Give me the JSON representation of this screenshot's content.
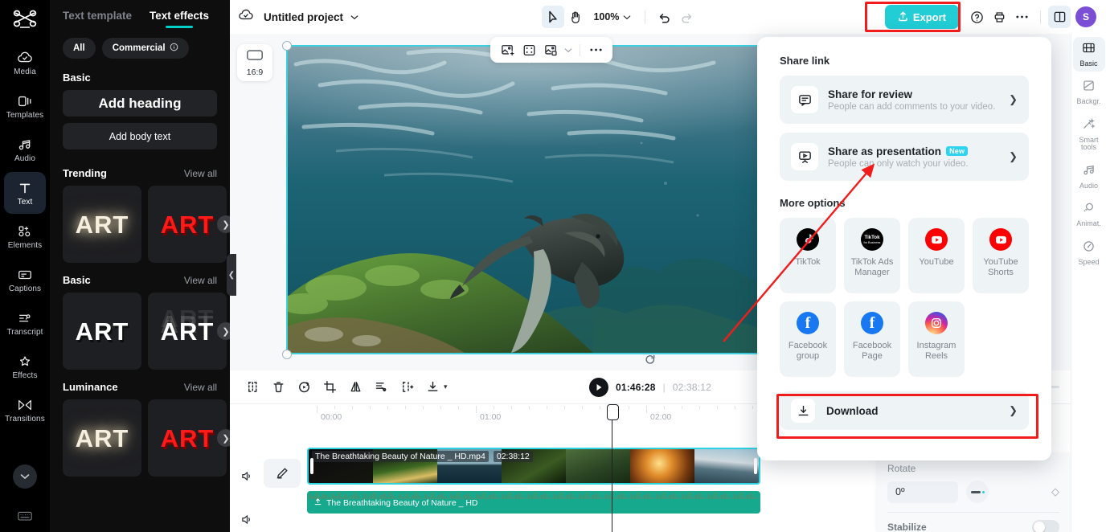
{
  "app": {
    "name": "CapCut",
    "logo_icon": "capcut-logo-icon"
  },
  "left_rail": {
    "items": [
      {
        "label": "Media",
        "icon": "cloud-media-icon",
        "active": false
      },
      {
        "label": "Templates",
        "icon": "templates-icon",
        "active": false
      },
      {
        "label": "Audio",
        "icon": "music-note-icon",
        "active": false
      },
      {
        "label": "Text",
        "icon": "text-t-icon",
        "active": true
      },
      {
        "label": "Elements",
        "icon": "elements-icon",
        "active": false
      },
      {
        "label": "Captions",
        "icon": "captions-icon",
        "active": false
      },
      {
        "label": "Transcript",
        "icon": "transcript-icon",
        "active": false
      },
      {
        "label": "Effects",
        "icon": "sparkle-effects-icon",
        "active": false
      },
      {
        "label": "Transitions",
        "icon": "transitions-icon",
        "active": false
      }
    ],
    "more_icon": "chevron-down-circle-icon",
    "keyboard_icon": "keyboard-shortcuts-icon"
  },
  "left_panel": {
    "tabs": [
      {
        "label": "Text template",
        "active": false
      },
      {
        "label": "Text effects",
        "active": true
      }
    ],
    "filters": [
      {
        "label": "All",
        "icon": null
      },
      {
        "label": "Commercial",
        "icon": "info-circle-icon"
      }
    ],
    "basic_heading": "Basic",
    "add_heading_label": "Add heading",
    "add_body_label": "Add body text",
    "sections": [
      {
        "title": "Trending",
        "view_all": "View all",
        "items": [
          "ART",
          "ART"
        ]
      },
      {
        "title": "Basic",
        "view_all": "View all",
        "items": [
          "ART",
          "ART"
        ]
      },
      {
        "title": "Luminance",
        "view_all": "View all",
        "items": [
          "ART",
          "ART"
        ]
      }
    ],
    "collapse_icon": "chevron-left-icon"
  },
  "topbar": {
    "cloud_icon": "cloud-saved-icon",
    "project_name": "Untitled project",
    "project_chevron": "chevron-down-icon",
    "select_tool_icon": "cursor-select-icon",
    "hand_tool_icon": "hand-pan-icon",
    "zoom_level": "100%",
    "zoom_chevron": "chevron-down-icon",
    "undo_icon": "undo-icon",
    "redo_icon": "redo-icon",
    "export_label": "Export",
    "export_icon": "export-upload-icon",
    "export_color": "#22cdd6",
    "help_icon": "help-question-icon",
    "print_icon": "print-icon",
    "more_icon": "more-horizontal-icon",
    "layout_icon": "panel-layout-icon",
    "avatar_initial": "S",
    "avatar_color": "#7a4fd6"
  },
  "preview": {
    "ratio_label": "16:9",
    "ratio_icon": "aspect-ratio-icon",
    "scene": "underwater marine iguana swimming over mossy rock",
    "tools": [
      {
        "icon": "add-image-icon",
        "name": "add-image"
      },
      {
        "icon": "fit-to-frame-icon",
        "name": "fit-to-frame"
      },
      {
        "icon": "crop-layer-icon",
        "name": "crop-layer"
      },
      {
        "icon": "chevron-down-icon",
        "name": "crop-dropdown"
      },
      {
        "icon": "more-horizontal-icon",
        "name": "more"
      }
    ],
    "rotate_handle_icon": "rotate-handle-icon",
    "selection_color": "#3ecfe0"
  },
  "player": {
    "tools": [
      {
        "icon": "split-icon",
        "name": "split"
      },
      {
        "icon": "trash-icon",
        "name": "delete"
      },
      {
        "icon": "reverse-icon",
        "name": "reverse"
      },
      {
        "icon": "crop-icon",
        "name": "crop"
      },
      {
        "icon": "mirror-icon",
        "name": "mirror"
      },
      {
        "icon": "cut-scissors-icon",
        "name": "cut"
      },
      {
        "icon": "freeze-icon",
        "name": "freeze"
      },
      {
        "icon": "download-icon",
        "name": "download"
      },
      {
        "icon": "chevron-down-icon",
        "name": "download-dropdown"
      }
    ],
    "play_icon": "play-icon",
    "current_time": "01:46:28",
    "separator": "|",
    "total_time": "02:38:12",
    "mic_icon": "microphone-icon",
    "auto_icon": "auto-enhance-icon",
    "audio_icon": "audio-waveform-icon",
    "zoom_out_icon": "zoom-out-circle-icon"
  },
  "timeline": {
    "ruler_labels": [
      "00:00",
      "01:00",
      "02:00"
    ],
    "tracks": [
      {
        "type": "video",
        "speaker_icon": "speaker-icon",
        "edit_icon": "edit-pencil-icon",
        "clip_name": "The Breathtaking Beauty of Nature _ HD.mp4",
        "clip_duration": "02:38:12"
      },
      {
        "type": "audio",
        "speaker_icon": "speaker-icon",
        "clip_icon": "audio-extract-icon",
        "clip_name": "The Breathtaking Beauty of Nature _ HD",
        "color": "#17a98e"
      }
    ],
    "playhead_icon": "playhead-icon"
  },
  "right_rail": {
    "items": [
      {
        "label": "Basic",
        "icon": "basic-film-icon",
        "active": true
      },
      {
        "label": "Backgr.",
        "icon": "background-icon",
        "active": false
      },
      {
        "label": "Smart tools",
        "icon": "smart-tools-wand-icon",
        "active": false
      },
      {
        "label": "Audio",
        "icon": "music-note-icon",
        "active": false
      },
      {
        "label": "Animat.",
        "icon": "animation-icon",
        "active": false
      },
      {
        "label": "Speed",
        "icon": "speed-gauge-icon",
        "active": false
      }
    ]
  },
  "properties": {
    "rotate_label": "Rotate",
    "rotate_value": "0º",
    "dial_icon": "rotate-dial-icon",
    "keyframe_icon": "keyframe-diamond-icon",
    "stabilize_label": "Stabilize",
    "stabilize_on": false
  },
  "share_panel": {
    "share_link_title": "Share link",
    "options": [
      {
        "title": "Share for review",
        "subtitle": "People can add comments to your video.",
        "icon": "comment-bubble-icon",
        "badge": null,
        "chevron": "chevron-right-icon"
      },
      {
        "title": "Share as presentation",
        "subtitle": "People can only watch your video.",
        "icon": "presentation-screen-icon",
        "badge": "New",
        "chevron": "chevron-right-icon"
      }
    ],
    "more_options_title": "More options",
    "tiles": [
      {
        "label": "TikTok",
        "icon": "tiktok-icon"
      },
      {
        "label": "TikTok Ads Manager",
        "icon": "tiktok-ads-manager-icon"
      },
      {
        "label": "YouTube",
        "icon": "youtube-icon"
      },
      {
        "label": "YouTube Shorts",
        "icon": "youtube-shorts-icon"
      },
      {
        "label": "Facebook group",
        "icon": "facebook-icon"
      },
      {
        "label": "Facebook Page",
        "icon": "facebook-icon"
      },
      {
        "label": "Instagram Reels",
        "icon": "instagram-icon"
      }
    ],
    "download_label": "Download",
    "download_icon": "download-icon",
    "download_chevron": "chevron-right-icon"
  },
  "annotations": {
    "highlight_color": "#f21c1c",
    "boxes": [
      "export-button",
      "download-row"
    ],
    "arrow_from": "download-row",
    "arrow_to": "share-as-presentation"
  }
}
